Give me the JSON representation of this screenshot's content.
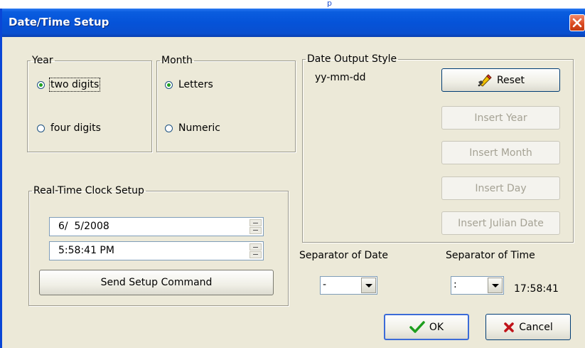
{
  "top_caption": "p",
  "window": {
    "title": "Date/Time Setup"
  },
  "year_group": {
    "legend": "Year",
    "options": [
      {
        "label": "two digits",
        "selected": true
      },
      {
        "label": "four digits",
        "selected": false
      }
    ]
  },
  "month_group": {
    "legend": "Month",
    "options": [
      {
        "label": "Letters",
        "selected": true
      },
      {
        "label": "Numeric",
        "selected": false
      }
    ]
  },
  "output_style": {
    "legend": "Date Output Style",
    "format": "yy-mm-dd",
    "buttons": {
      "reset": "Reset",
      "insert_year": "Insert Year",
      "insert_month": "Insert Month",
      "insert_day": "Insert Day",
      "insert_julian": "Insert Julian Date"
    }
  },
  "rtc": {
    "legend": "Real-Time Clock Setup",
    "date_value": "6/  5/2008",
    "time_value": "5:58:41 PM",
    "send_label": "Send Setup Command"
  },
  "separators": {
    "date_label": "Separator of Date",
    "date_value": "-",
    "time_label": "Separator of Time",
    "time_value": ":",
    "clock": "17:58:41"
  },
  "actions": {
    "ok": "OK",
    "cancel": "Cancel"
  },
  "colors": {
    "title_bar": "#0553d8",
    "face": "#ece9d8",
    "ok_check": "#1e9e1e",
    "cancel_x": "#c0141a"
  }
}
